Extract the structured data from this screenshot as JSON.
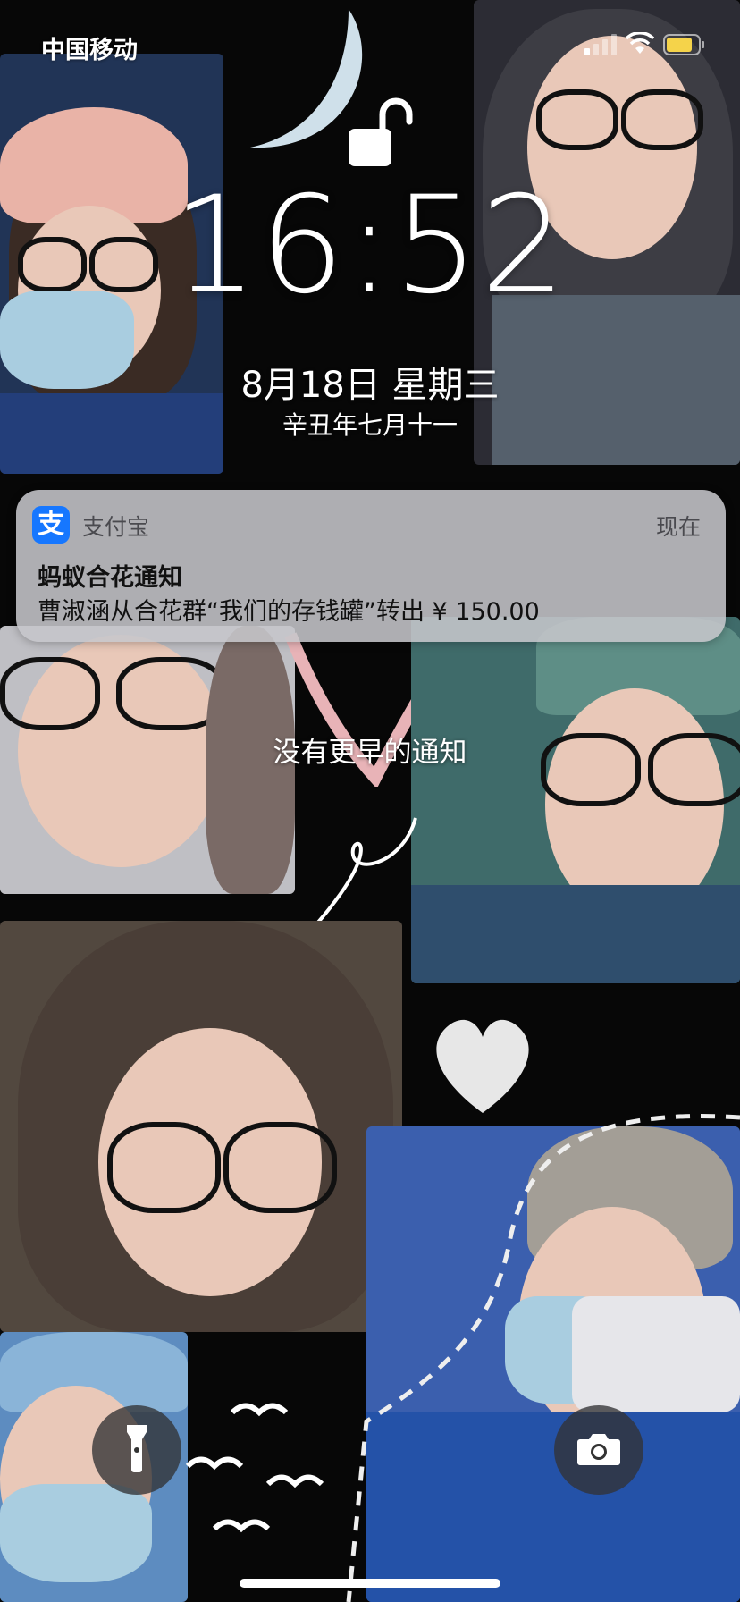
{
  "status_bar": {
    "carrier": "中国移动",
    "signal_icon": "cellular-signal-icon",
    "wifi_icon": "wifi-icon",
    "battery_icon": "battery-icon",
    "battery_color": "#f5d34a"
  },
  "lock": {
    "icon": "unlocked-padlock-icon"
  },
  "clock": {
    "time": "16:52",
    "date": "8月18日 星期三",
    "lunar_date": "辛丑年七月十一"
  },
  "notification": {
    "app_icon": "alipay-icon",
    "app_icon_glyph": "支",
    "app_icon_color": "#1677ff",
    "app_name": "支付宝",
    "time": "现在",
    "title": "蚂蚁合花通知",
    "body": "曹淑涵从合花群“我们的存钱罐”转出 ¥ 150.00"
  },
  "no_earlier_notifications": "没有更早的通知",
  "quick_actions": {
    "flashlight_icon": "flashlight-icon",
    "camera_icon": "camera-icon"
  }
}
